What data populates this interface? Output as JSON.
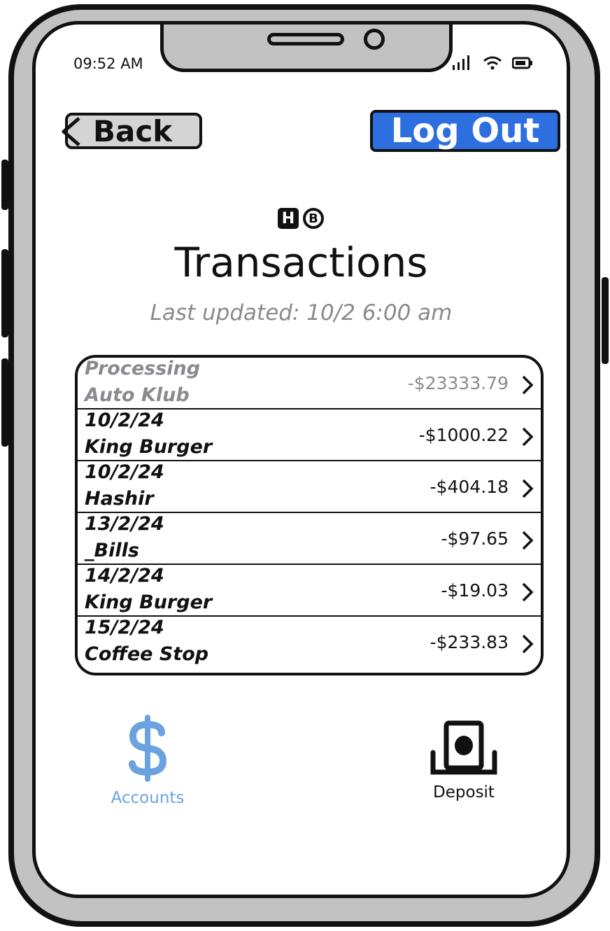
{
  "status": {
    "time": "09:52 AM"
  },
  "header": {
    "back_label": "Back",
    "logout_label": "Log Out"
  },
  "logo": {
    "left": "H",
    "right": "B"
  },
  "page": {
    "title": "Transactions",
    "updated": "Last updated: 10/2 6:00 am"
  },
  "transactions": [
    {
      "date": "Processing",
      "name": "Auto Klub",
      "amount": "-$23333.79",
      "processing": true
    },
    {
      "date": "10/2/24",
      "name": "King Burger",
      "amount": "-$1000.22"
    },
    {
      "date": "10/2/24",
      "name": "Hashir",
      "amount": "-$404.18"
    },
    {
      "date": "13/2/24",
      "name": "_Bills",
      "amount": "-$97.65"
    },
    {
      "date": "14/2/24",
      "name": "King Burger",
      "amount": "-$19.03"
    },
    {
      "date": "15/2/24",
      "name": "Coffee Stop",
      "amount": "-$233.83"
    }
  ],
  "nav": {
    "accounts_label": "Accounts",
    "deposit_label": "Deposit",
    "accounts_icon": "dollar-icon",
    "deposit_icon": "deposit-check-icon"
  },
  "colors": {
    "accent": "#2e6fe0",
    "nav_active": "#6aa3e0",
    "muted": "#8a8a8a",
    "frame": "#c2c2c2"
  }
}
